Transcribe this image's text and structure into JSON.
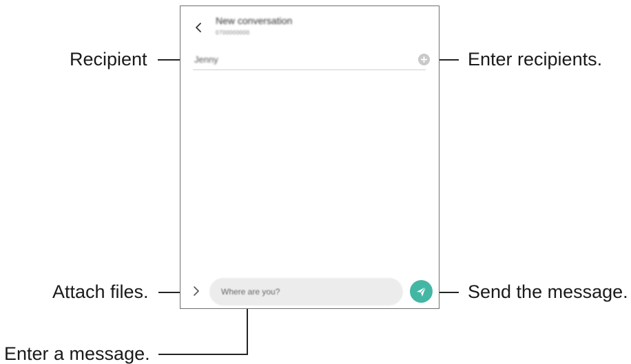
{
  "screen": {
    "header_title": "New conversation",
    "header_subtitle": "0700000000",
    "recipient_value": "Jenny",
    "message_placeholder": "Where are you?"
  },
  "callouts": {
    "recipient": "Recipient",
    "enter_recipients": "Enter recipients.",
    "attach_files": "Attach files.",
    "send_message": "Send the message.",
    "enter_message": "Enter a message."
  },
  "icons": {
    "back": "chevron-left-icon",
    "add_recipient": "plus-circle-icon",
    "attach": "chevron-right-icon",
    "send": "paper-plane-icon"
  },
  "colors": {
    "send_button": "#44b6a4",
    "frame_border": "#6e6e6e",
    "input_background": "#ececec"
  }
}
